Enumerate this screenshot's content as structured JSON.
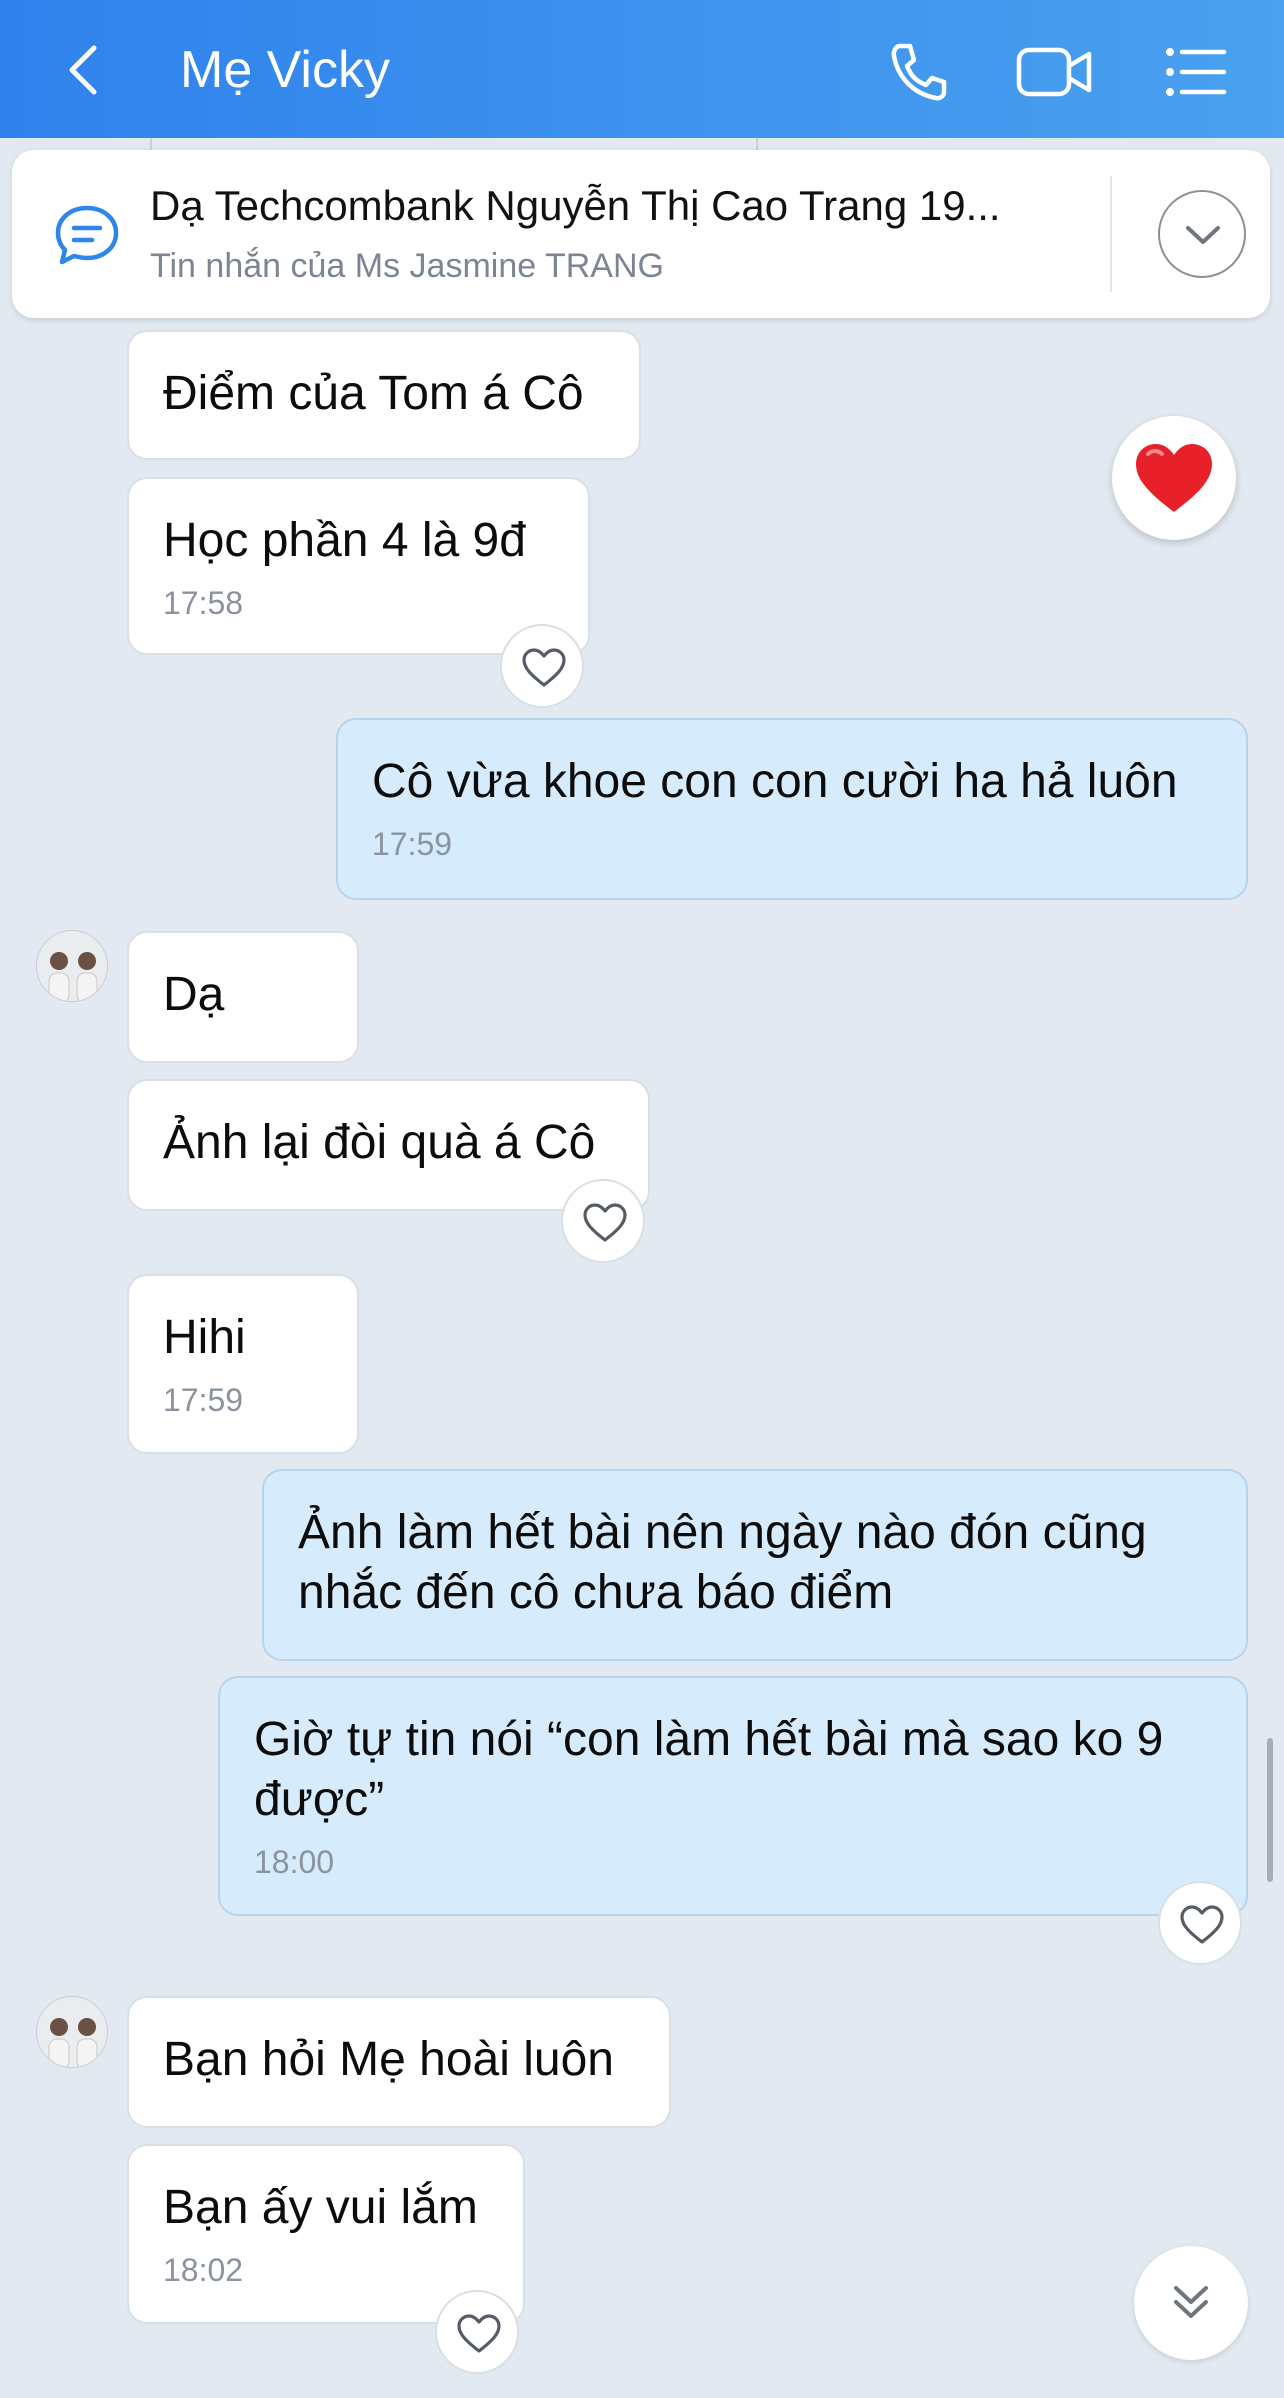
{
  "header": {
    "title": "Mẹ Vicky"
  },
  "icons": {
    "back": "chevron-left-icon",
    "call": "phone-icon",
    "video": "video-camera-icon",
    "menu": "list-menu-icon",
    "pinned": "chat-bubble-icon",
    "expand": "chevron-down-icon",
    "reaction": "heart-outline-icon",
    "scroll": "double-chevron-down-icon"
  },
  "pinned": {
    "text": "Dạ Techcombank Nguyễn Thị Cao Trang 19...",
    "subtitle": "Tin nhắn của Ms Jasmine TRANG"
  },
  "messages": [
    {
      "side": "in",
      "text": "Điểm của Tom á Cô"
    },
    {
      "side": "in",
      "text": "Học phần 4 là 9đ",
      "time": "17:58"
    },
    {
      "side": "out",
      "text": "Cô vừa khoe con con cười ha hả luôn",
      "time": "17:59"
    },
    {
      "side": "in",
      "text": "Dạ"
    },
    {
      "side": "in",
      "text": "Ảnh lại đòi quà á Cô"
    },
    {
      "side": "in",
      "text": "Hihi",
      "time": "17:59"
    },
    {
      "side": "out",
      "text": "Ảnh làm hết bài nên ngày nào đón cũng nhắc đến cô chưa báo điểm"
    },
    {
      "side": "out",
      "text": "Giờ tự tin nói “con làm hết bài mà sao ko 9 được”",
      "time": "18:00"
    },
    {
      "side": "in",
      "text": "Bạn hỏi Mẹ hoài luôn"
    },
    {
      "side": "in",
      "text": "Bạn ấy vui lắm",
      "time": "18:02"
    }
  ],
  "colors": {
    "header": "#3a8fee",
    "background": "#e2e9f1",
    "incoming_bubble": "#ffffff",
    "outgoing_bubble": "#d6ecfd",
    "reaction_heart": "#e8202a"
  }
}
